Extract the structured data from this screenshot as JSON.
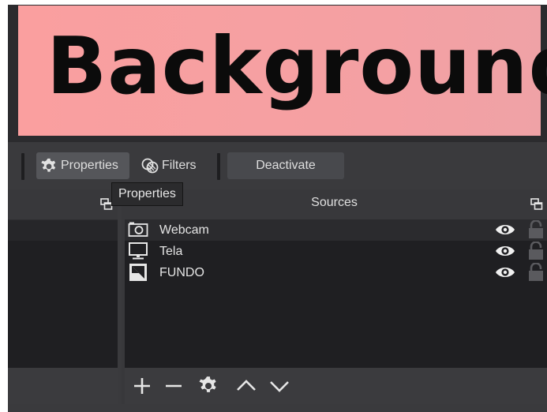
{
  "preview": {
    "text": "Background",
    "background_color": "#f7a0a2"
  },
  "toolbar": {
    "properties_label": "Properties",
    "filters_label": "Filters",
    "deactivate_label": "Deactivate"
  },
  "tooltip": {
    "text": "Properties"
  },
  "sources": {
    "title": "Sources",
    "items": [
      {
        "name": "Webcam",
        "icon": "camera-icon",
        "visible": true,
        "locked": false
      },
      {
        "name": "Tela",
        "icon": "monitor-icon",
        "visible": true,
        "locked": false
      },
      {
        "name": "FUNDO",
        "icon": "image-icon",
        "visible": true,
        "locked": false
      }
    ],
    "footer_buttons": [
      "add-icon",
      "remove-icon",
      "gear-icon",
      "chevron-up-icon",
      "chevron-down-icon"
    ]
  },
  "colors": {
    "panel": "#3a3a3d",
    "list": "#1f1f22",
    "text": "#e4e4e4"
  }
}
